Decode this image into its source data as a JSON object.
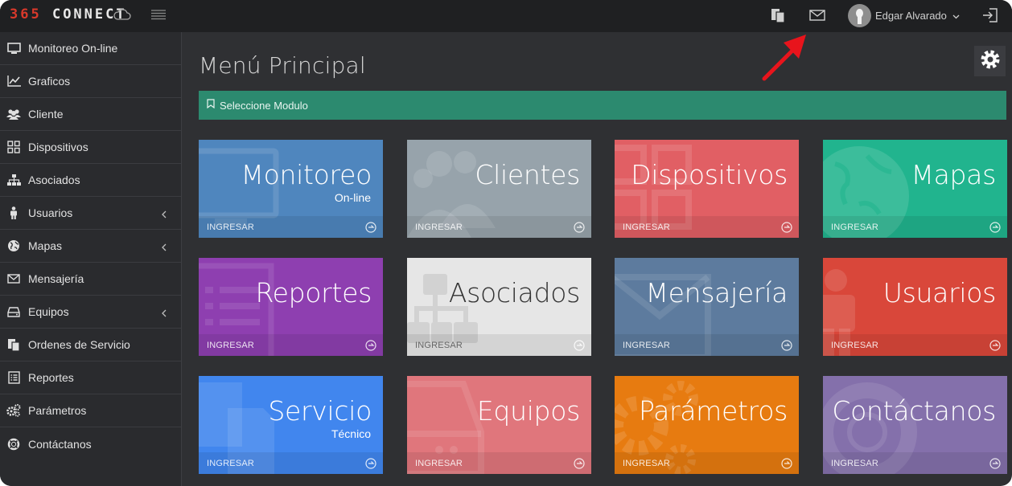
{
  "brand": {
    "number": "365",
    "name": " CONNECT"
  },
  "user": {
    "name": "Edgar Alvarado"
  },
  "sidebar": {
    "items": [
      {
        "label": "Monitoreo On-line"
      },
      {
        "label": "Graficos"
      },
      {
        "label": "Cliente"
      },
      {
        "label": "Dispositivos"
      },
      {
        "label": "Asociados"
      },
      {
        "label": "Usuarios"
      },
      {
        "label": "Mapas"
      },
      {
        "label": "Mensajería"
      },
      {
        "label": "Equipos"
      },
      {
        "label": "Ordenes de Servicio"
      },
      {
        "label": "Reportes"
      },
      {
        "label": "Parámetros"
      },
      {
        "label": "Contáctanos"
      }
    ]
  },
  "main": {
    "title": "Menú Principal",
    "alert": "Seleccione Modulo",
    "tiles": [
      {
        "title": "Monitoreo",
        "sub": "On-line",
        "action": "INGRESAR",
        "color": "#4f86be"
      },
      {
        "title": "Clientes",
        "sub": "",
        "action": "INGRESAR",
        "color": "#97a3ab"
      },
      {
        "title": "Dispositivos",
        "sub": "",
        "action": "INGRESAR",
        "color": "#e15f64"
      },
      {
        "title": "Mapas",
        "sub": "",
        "action": "INGRESAR",
        "color": "#21b48e"
      },
      {
        "title": "Reportes",
        "sub": "",
        "action": "INGRESAR",
        "color": "#8e3fb0"
      },
      {
        "title": "Asociados",
        "sub": "",
        "action": "INGRESAR",
        "color": "#e6e6e6"
      },
      {
        "title": "Mensajería",
        "sub": "",
        "action": "INGRESAR",
        "color": "#5d7b9e"
      },
      {
        "title": "Usuarios",
        "sub": "",
        "action": "INGRESAR",
        "color": "#d9473a"
      },
      {
        "title": "Servicio",
        "sub": "Técnico",
        "action": "INGRESAR",
        "color": "#4186ee"
      },
      {
        "title": "Equipos",
        "sub": "",
        "action": "INGRESAR",
        "color": "#e0767c"
      },
      {
        "title": "Parámetros",
        "sub": "",
        "action": "INGRESAR",
        "color": "#e77b10"
      },
      {
        "title": "Contáctanos",
        "sub": "",
        "action": "INGRESAR",
        "color": "#8470ab"
      }
    ]
  },
  "colors": {
    "topbar": "#1f2022",
    "sidebar": "#2a2b2e",
    "background": "#2f3033",
    "alert": "#2c8a6f",
    "annotation_arrow": "#e8141c"
  }
}
